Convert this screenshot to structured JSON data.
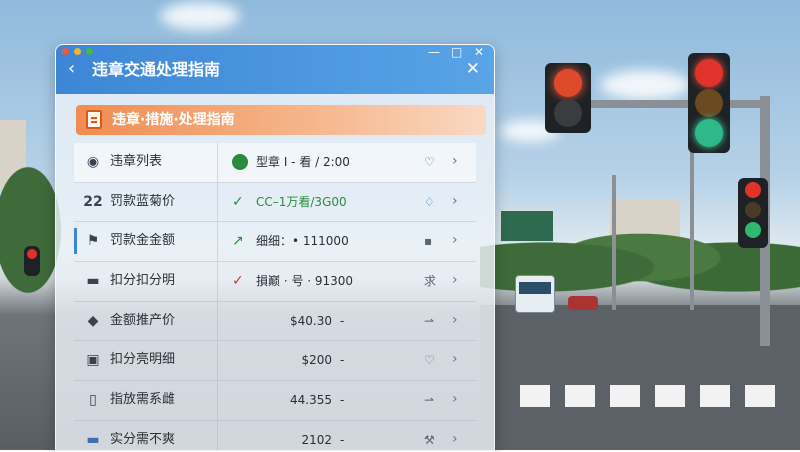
{
  "window": {
    "title": "违章交通处理指南"
  },
  "banner": {
    "text": "违章·措施·处理指南",
    "icon": "document-icon"
  },
  "rows": [
    {
      "left_icon": "person-icon",
      "left_label": "违章列表",
      "right_icon": "status-icon",
      "right_value": "型章 I - 看 / 2:00",
      "action_icon": "heart-icon"
    },
    {
      "left_icon": "number-icon",
      "left_glyph": "22",
      "left_label": "罚款蓝菊价",
      "right_icon": "check-icon",
      "right_value": "CC–1万看/3G00",
      "action_icon": "bell-icon"
    },
    {
      "left_icon": "flag-icon",
      "left_label": "罚款金金额",
      "right_icon": "trend-icon",
      "right_value": "细细：• 111000",
      "action_icon": "message-icon"
    },
    {
      "left_icon": "car-icon",
      "left_label": "扣分扣分明",
      "right_icon": "check-icon",
      "right_value": "損巅 · 号 · 91300",
      "action_icon": "text-icon",
      "action_text": "求"
    },
    {
      "left_icon": "shield-icon",
      "left_label": "金额推产价",
      "right_value": "$40.30",
      "dash": "-",
      "action_icon": "link-icon"
    },
    {
      "left_icon": "car-icon",
      "left_label": "扣分亮明细",
      "right_value": "$200",
      "dash": "-",
      "action_icon": "heart-icon"
    },
    {
      "left_icon": "device-icon",
      "left_label": "指放需系雌",
      "right_value": "44.355",
      "dash": "-",
      "action_icon": "link-icon"
    },
    {
      "left_icon": "car-icon",
      "left_label": "实分需不爽",
      "right_value": "2102",
      "dash": "-",
      "action_icon": "tool-icon"
    }
  ],
  "colors": {
    "accent": "#3d86d6",
    "banner": "#ef8c52",
    "ok": "#2a8a3e",
    "warn": "#c8352c"
  }
}
